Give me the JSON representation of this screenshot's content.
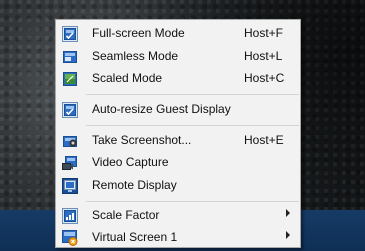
{
  "menu": {
    "items": [
      {
        "label": "Full-screen Mode",
        "shortcut": "Host+F",
        "icon": "full-screen-icon",
        "checked": true
      },
      {
        "label": "Seamless Mode",
        "shortcut": "Host+L",
        "icon": "seamless-mode-icon"
      },
      {
        "label": "Scaled Mode",
        "shortcut": "Host+C",
        "icon": "scaled-mode-icon"
      },
      {
        "label": "Auto-resize Guest Display",
        "shortcut": "",
        "icon": "auto-resize-icon",
        "checked": true
      },
      {
        "label": "Take Screenshot...",
        "shortcut": "Host+E",
        "icon": "camera-icon"
      },
      {
        "label": "Video Capture",
        "shortcut": "",
        "icon": "video-capture-icon"
      },
      {
        "label": "Remote Display",
        "shortcut": "",
        "icon": "remote-display-icon"
      },
      {
        "label": "Scale Factor",
        "shortcut": "",
        "icon": "scale-factor-icon",
        "submenu": true
      },
      {
        "label": "Virtual Screen 1",
        "shortcut": "",
        "icon": "virtual-screen-icon",
        "submenu": true
      }
    ]
  },
  "colors": {
    "menu_background": "#f2f2f2",
    "icon_blue": "#2b6cc4",
    "desktop_band": "#153b66"
  }
}
